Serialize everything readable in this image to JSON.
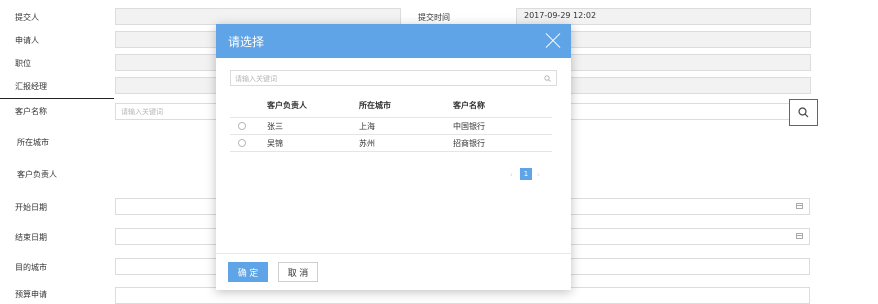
{
  "form": {
    "submitter_label": "提交人",
    "submit_time_label": "提交时间",
    "submit_time_value": "2017-09-29 12:02",
    "applicant_label": "申请人",
    "position_label": "职位",
    "report_manager_label": "汇报经理",
    "customer_name_label": "客户名称",
    "customer_name_placeholder": "请输入关键词",
    "city_label": "所在城市",
    "owner_label": "客户负责人",
    "start_date_label": "开始日期",
    "end_date_label": "结束日期",
    "dest_city_label": "目的城市",
    "budget_label": "预算申请"
  },
  "modal": {
    "title": "请选择",
    "search_placeholder": "请输入关键词",
    "columns": [
      "客户负责人",
      "所在城市",
      "客户名称"
    ],
    "rows": [
      {
        "owner": "张三",
        "city": "上海",
        "customer": "中国银行"
      },
      {
        "owner": "吴锦",
        "city": "苏州",
        "customer": "招商银行"
      }
    ],
    "pager": {
      "prev": "‹",
      "current": "1",
      "next": "›"
    },
    "ok_label": "确 定",
    "cancel_label": "取 消"
  },
  "icons": {
    "search": "search-icon",
    "calendar": "calendar-icon",
    "close": "close-icon"
  },
  "colors": {
    "modal_header": "#5ea4e6",
    "primary_button": "#5ea4e6",
    "highlight_border": "#e0312f"
  }
}
